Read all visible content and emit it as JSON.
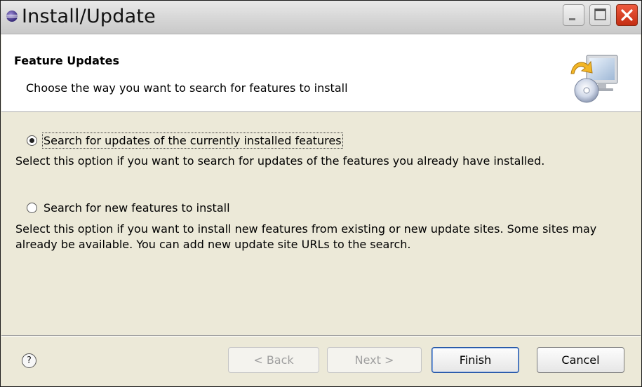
{
  "window": {
    "title": "Install/Update"
  },
  "header": {
    "title": "Feature Updates",
    "description": "Choose the way you want to search for features to install"
  },
  "options": [
    {
      "label": "Search for updates of the currently installed features",
      "description": "Select this option if you want to search for updates of the features you already have installed.",
      "selected": true
    },
    {
      "label": "Search for new features to install",
      "description": "Select this option if you want to install new features from existing or new update sites. Some sites may already be available. You can add new update site URLs to the search.",
      "selected": false
    }
  ],
  "footer": {
    "help_glyph": "?",
    "back_label": "< Back",
    "next_label": "Next >",
    "finish_label": "Finish",
    "cancel_label": "Cancel"
  },
  "colors": {
    "dialog_bg": "#ece9d8",
    "header_bg": "#ffffff",
    "close_button": "#d4401e",
    "default_button_border": "#1c4ea0"
  },
  "icons": {
    "app": "eclipse-icon",
    "header": "install-update-cd-monitor-icon",
    "help": "help-icon"
  }
}
